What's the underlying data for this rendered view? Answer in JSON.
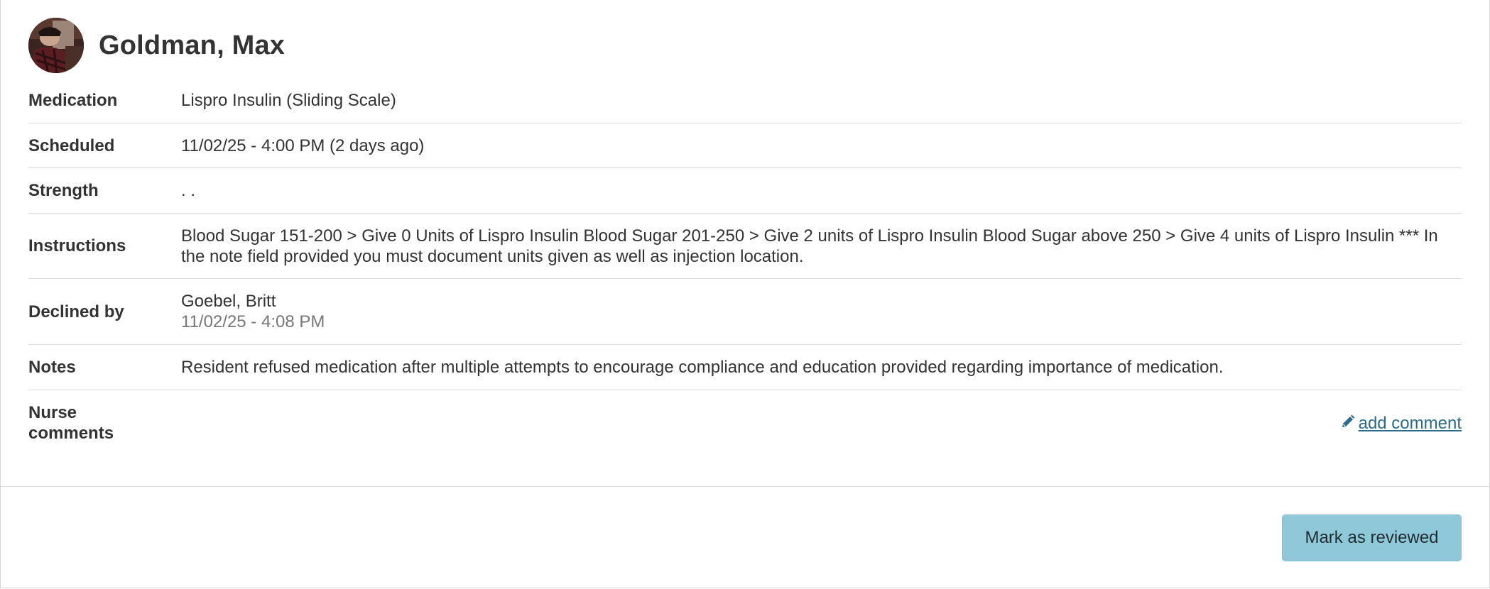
{
  "patient": {
    "name": "Goldman, Max"
  },
  "details": {
    "medication": {
      "label": "Medication",
      "value": "Lispro Insulin (Sliding Scale)"
    },
    "scheduled": {
      "label": "Scheduled",
      "value": "11/02/25 - 4:00 PM (2 days ago)"
    },
    "strength": {
      "label": "Strength",
      "value": ". ."
    },
    "instructions": {
      "label": "Instructions",
      "value": "Blood Sugar 151-200 > Give 0 Units of Lispro Insulin Blood Sugar 201-250 > Give 2 units of Lispro Insulin Blood Sugar above 250 > Give 4 units of Lispro Insulin *** In the note field provided you must document units given as well as injection location."
    },
    "declined_by": {
      "label": "Declined by",
      "name": "Goebel, Britt",
      "time": "11/02/25 - 4:08 PM"
    },
    "notes": {
      "label": "Notes",
      "value": "Resident refused medication after multiple attempts to encourage compliance and education provided regarding importance of medication."
    },
    "nurse_comments": {
      "label_line1": "Nurse",
      "label_line2": "comments",
      "add_link": "add comment",
      "icon": "pencil-icon"
    }
  },
  "footer": {
    "review_button": "Mark as reviewed"
  },
  "colors": {
    "link": "#2c6a8a",
    "button_bg": "#8fc9d9",
    "text": "#333333",
    "muted": "#777777"
  }
}
